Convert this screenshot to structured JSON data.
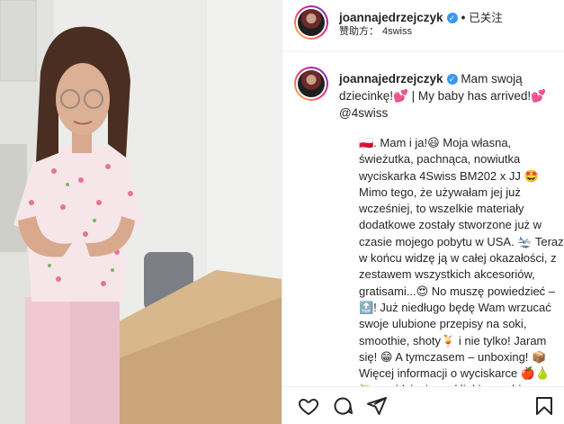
{
  "header": {
    "username": "joannajedrzejczyk",
    "follow_state": "已关注",
    "sponsor_label": "赞助方：",
    "sponsor_brand": "4swiss"
  },
  "caption": {
    "username": "joannajedrzejczyk",
    "title_text": " Mam swoją dziecinkę!💕 | My baby has arrived!💕 @4swiss",
    "lines": [
      "🇵🇱. Mam i ja!😃 Moja własna,",
      "świeżutka, pachnąca, nowiutka",
      "wyciskarka 4Swiss BM202 x JJ 🤩",
      "Mimo tego, że używałam jej już",
      "wcześniej, to wszelkie materiały",
      "dodatkowe zostały stworzone już w",
      "czasie mojego pobytu w USA. 🛬 Teraz",
      "w końcu widzę ją w całej okazałości, z",
      "zestawem wszystkich akcesoriów,",
      "gratisami...😍 No muszę powiedzieć –",
      "🔝! Już niedługo będę Wam wrzucać",
      "swoje ulubione przepisy na soki,",
      "smoothie, shoty🍹 i nie tylko! Jaram",
      "się! 😁 A tymczasem – unboxing! 📦",
      "Więcej informacji o wyciskarce 🍎🍐",
      "🍋 znajdziecie pod linkiem w bio →"
    ]
  },
  "actions": {
    "like": "heart-outline",
    "comment": "speech-bubble",
    "share": "paper-plane",
    "save": "bookmark"
  },
  "colors": {
    "verified": "#3897f0",
    "text": "#262626",
    "divider": "#efefef"
  }
}
